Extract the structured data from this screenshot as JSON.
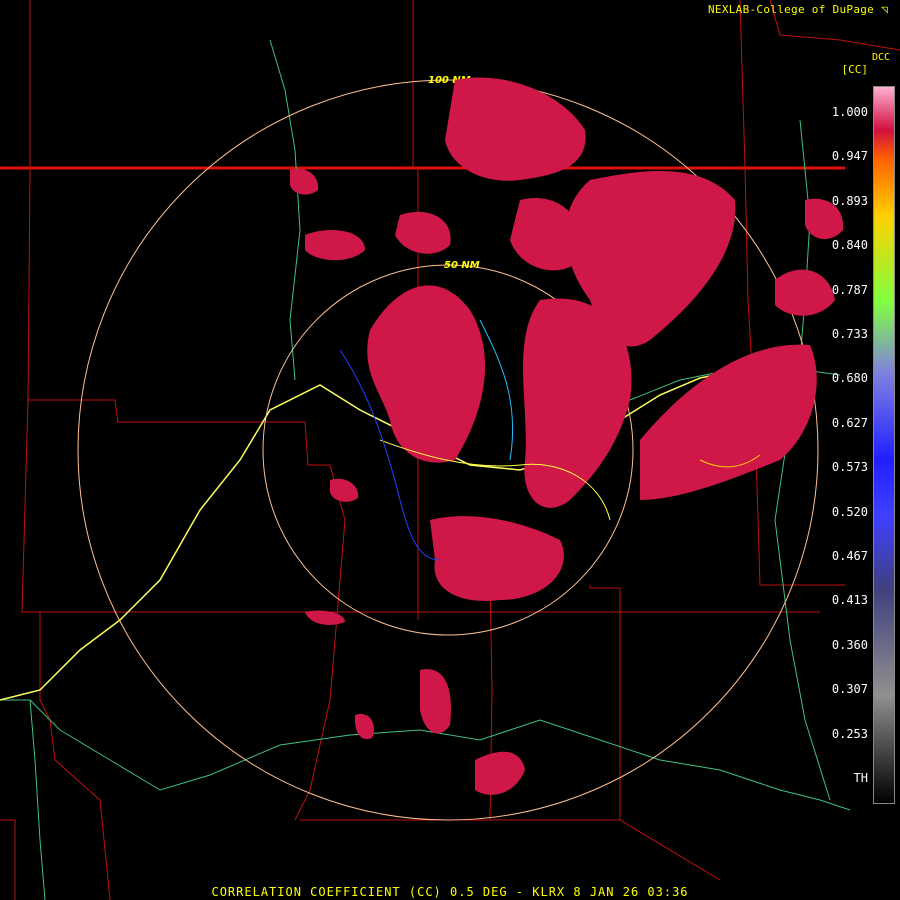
{
  "header": {
    "credit": "NEXLAB-College of DuPage",
    "station": "DCC",
    "unit": "[CC]"
  },
  "caption": "CORRELATION COEFFICIENT (CC) 0.5 DEG - KLRX 8 JAN 26 03:36",
  "range_rings": {
    "inner_label": "50 NM",
    "outer_label": "100 NM"
  },
  "colorbar": {
    "ticks": [
      "1.000",
      "0.947",
      "0.893",
      "0.840",
      "0.787",
      "0.733",
      "0.680",
      "0.627",
      "0.573",
      "0.520",
      "0.467",
      "0.413",
      "0.360",
      "0.307",
      "0.253",
      "TH"
    ],
    "colors": [
      "#ffb0d0",
      "#d01040",
      "#ff6000",
      "#ffd000",
      "#80ff40",
      "#8080e0",
      "#2020ff",
      "#4040ff",
      "#404080",
      "#909090",
      "#000000"
    ]
  },
  "icons": {
    "credit_logo": "nexlab-logo-icon"
  },
  "map_colors": {
    "state_boundary": "#e01010",
    "county_boundary": "#b01010",
    "highway": "#ffff60",
    "rivers": "#40c080",
    "range_ring": "#ffc090",
    "echo": "#d01848"
  }
}
